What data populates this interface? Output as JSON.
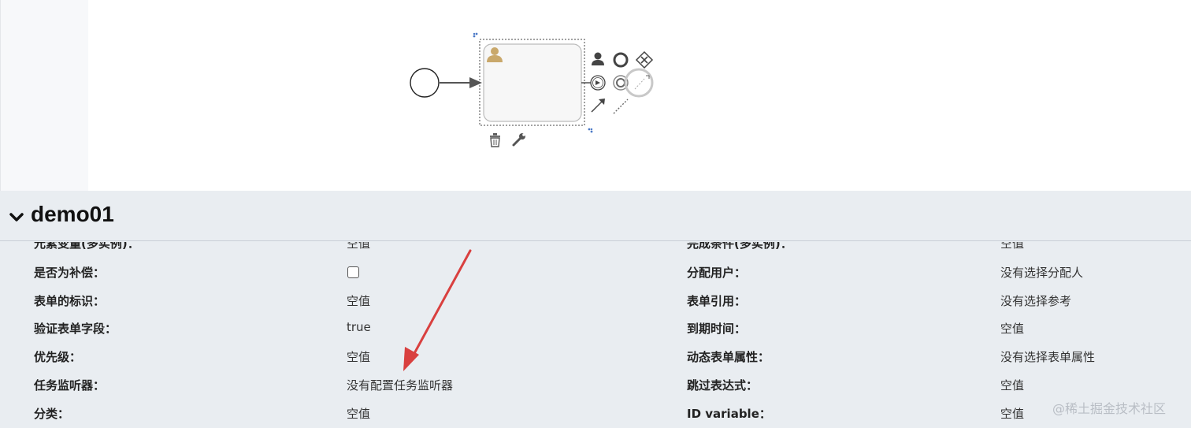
{
  "panel": {
    "title": "demo01"
  },
  "properties": [
    {
      "label_left": "元素变量(多实例)：",
      "value_left": "空值",
      "label_right": "完成条件(多实例)：",
      "value_right": "空值"
    },
    {
      "label_left": "是否为补偿：",
      "value_left": "",
      "label_right": "分配用户：",
      "value_right": "没有选择分配人"
    },
    {
      "label_left": "表单的标识：",
      "value_left": "空值",
      "label_right": "表单引用：",
      "value_right": "没有选择参考"
    },
    {
      "label_left": "验证表单字段：",
      "value_left": "true",
      "label_right": "到期时间：",
      "value_right": "空值"
    },
    {
      "label_left": "优先级：",
      "value_left": "空值",
      "label_right": "动态表单属性：",
      "value_right": "没有选择表单属性"
    },
    {
      "label_left": "任务监听器：",
      "value_left": "没有配置任务监听器",
      "label_right": "跳过表达式：",
      "value_right": "空值"
    },
    {
      "label_left": "分类：",
      "value_left": "空值",
      "label_right": "ID variable：",
      "value_right": "空值"
    }
  ],
  "is_compensation_checked": false,
  "watermark": "@稀土掘金技术社区",
  "icons": {
    "task_type": "user-icon",
    "context_pad": [
      "user-icon",
      "end-event-icon",
      "gateway-x-icon",
      "intermediate-event-icon",
      "boundary-event-icon",
      "connect-arrow-icon",
      "association-icon"
    ],
    "task_tools": [
      "trash-icon",
      "wrench-icon"
    ]
  },
  "colors": {
    "panel_bg": "#e9edf1",
    "annotation_arrow": "#d9403f",
    "user_icon": "#c9a86b"
  }
}
